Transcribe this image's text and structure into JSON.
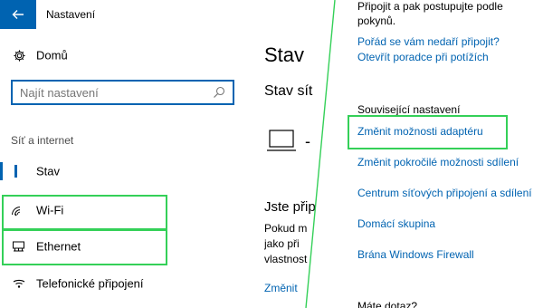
{
  "titlebar": {
    "title": "Nastavení"
  },
  "nav": {
    "home_label": "Domů",
    "search_placeholder": "Najít nastavení",
    "section_label": "Síť a internet",
    "items": [
      {
        "label": "Stav",
        "icon": "globe-status-icon"
      },
      {
        "label": "Wi-Fi",
        "icon": "wifi-icon"
      },
      {
        "label": "Ethernet",
        "icon": "ethernet-icon"
      },
      {
        "label": "Telefonické připojení",
        "icon": "dialup-icon"
      }
    ]
  },
  "main": {
    "heading": "Stav",
    "subheading": "Stav sít",
    "status_dash": "-",
    "connect_heading": "Jste přip",
    "body_lines": [
      "Pokud m",
      "jako při",
      "vlastnost"
    ],
    "change_link": "Změnit"
  },
  "panel": {
    "intro_line1": "Připojit a pak postupujte podle",
    "intro_line2": "pokynů.",
    "help_link": "Pořád se vám nedaří připojit?",
    "troubleshoot_link": "Otevřít poradce při potížích",
    "related_heading": "Související nastavení",
    "related_links": [
      "Změnit možnosti adaptéru",
      "Změnit pokročilé možnosti sdílení",
      "Centrum síťových připojení a sdílení",
      "Domácí skupina",
      "Brána Windows Firewall"
    ],
    "question_heading": "Máte dotaz?"
  },
  "colors": {
    "accent": "#0063b1",
    "highlight_box": "#34d058"
  }
}
